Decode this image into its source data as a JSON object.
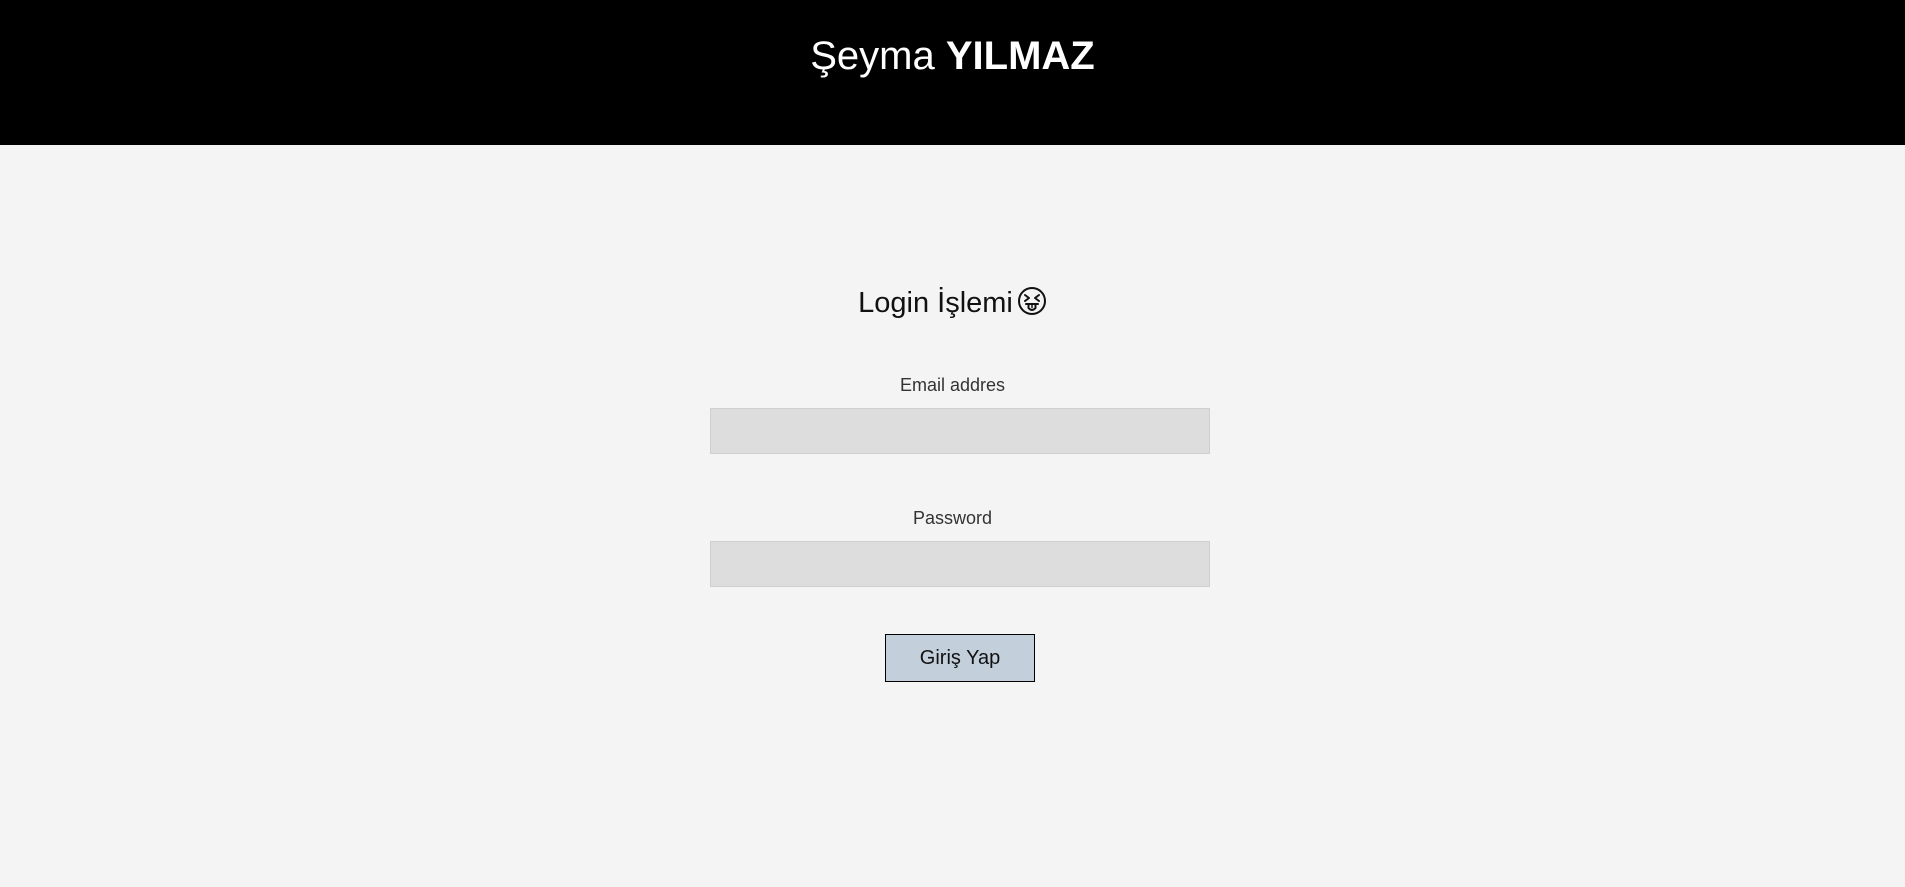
{
  "header": {
    "first_name": "Şeyma",
    "last_name": "YILMAZ"
  },
  "login": {
    "heading": "Login İşlemi",
    "heading_icon": "face-with-tongue-and-squinting-eyes-icon",
    "email_label": "Email addres",
    "email_value": "",
    "password_label": "Password",
    "password_value": "",
    "submit_label": "Giriş Yap"
  },
  "colors": {
    "header_bg": "#000000",
    "page_bg": "#f4f4f4",
    "input_bg": "#dddddd",
    "button_bg": "#c3cfda"
  }
}
